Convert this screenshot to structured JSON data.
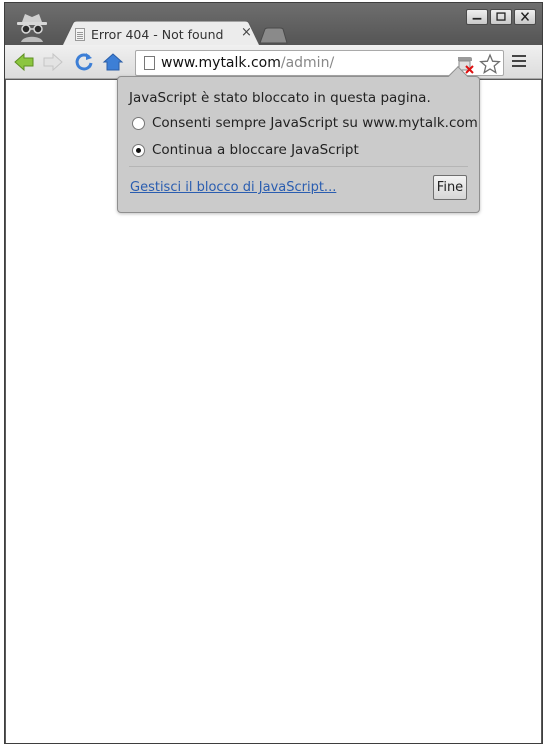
{
  "window": {
    "minimize_label": "minimize",
    "maximize_label": "maximize",
    "close_label": "close"
  },
  "tab": {
    "title": "Error 404 - Not found",
    "close_glyph": "×"
  },
  "omnibox": {
    "host": "www.mytalk.com",
    "path": "/admin/"
  },
  "js_bubble": {
    "heading": "JavaScript è stato bloccato in questa pagina.",
    "options": [
      {
        "label": "Consenti sempre JavaScript su www.mytalk.com",
        "selected": false
      },
      {
        "label": "Continua a bloccare JavaScript",
        "selected": true
      }
    ],
    "manage_link": "Gestisci il blocco di JavaScript...",
    "done_button": "Fine"
  },
  "icons": {
    "incognito": "incognito-icon",
    "back": "back-arrow-icon",
    "forward": "forward-arrow-icon",
    "reload": "reload-icon",
    "home": "home-icon",
    "page": "page-icon",
    "js_blocked": "javascript-blocked-icon",
    "bookmark": "star-icon",
    "menu": "hamburger-menu-icon"
  },
  "colors": {
    "frame": "#5a5a5a",
    "toolbar": "#e6e6e6",
    "bubble": "#cbcbcb",
    "link": "#2a5db0",
    "nav_arrow": "#8cc63f",
    "reload_home": "#3d7fd6"
  }
}
